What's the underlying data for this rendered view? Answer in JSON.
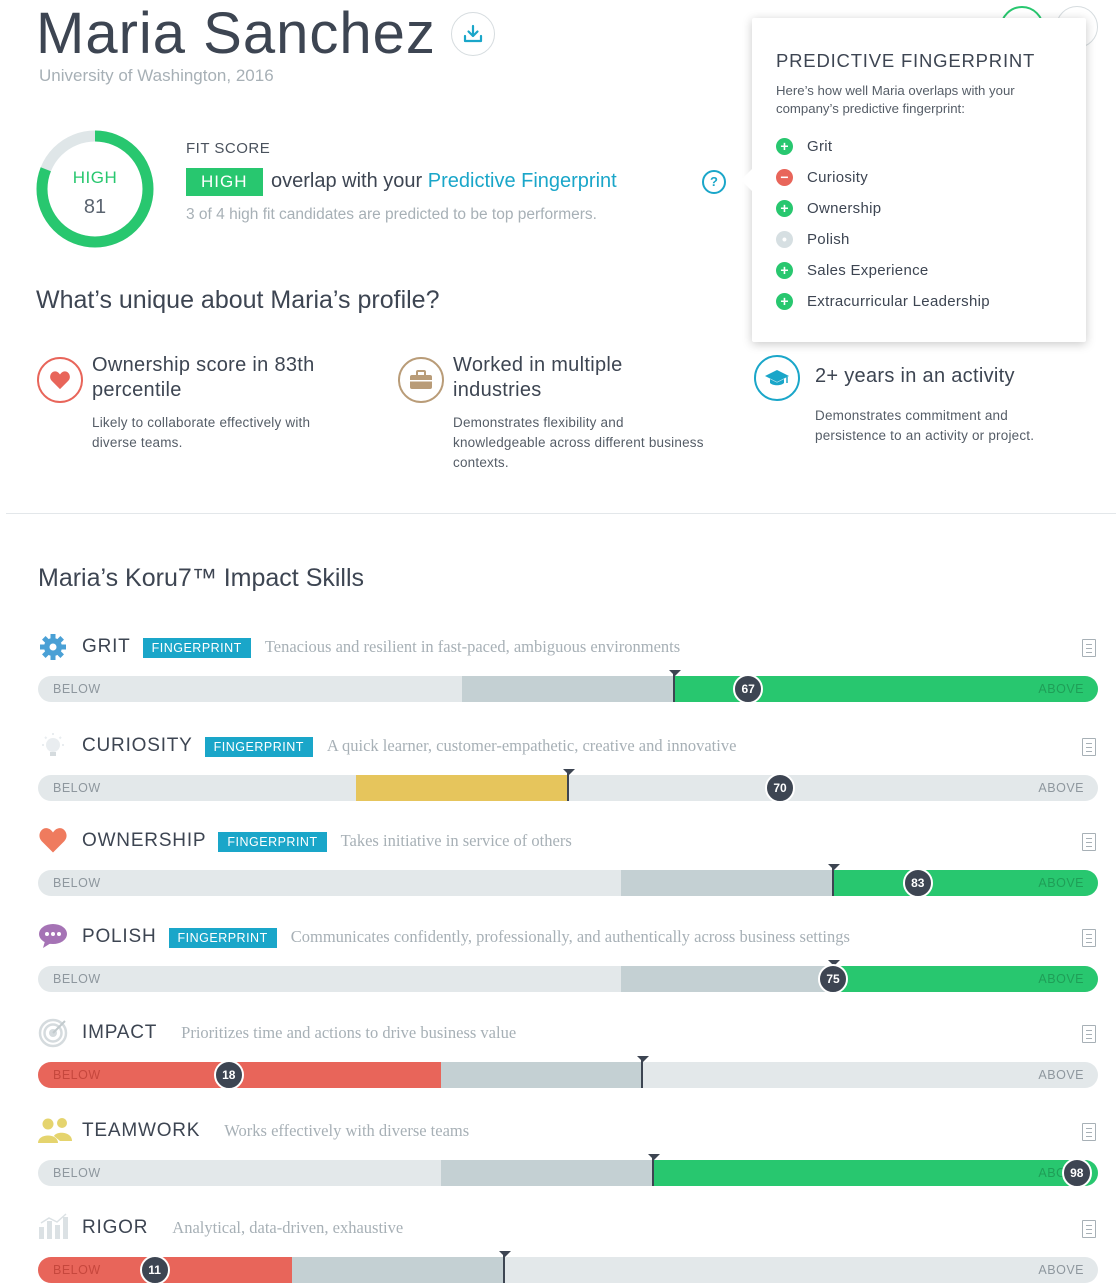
{
  "profile": {
    "name": "Maria Sanchez",
    "education": "University of Washington, 2016"
  },
  "fit": {
    "level": "HIGH",
    "score": "81",
    "score_fraction": 0.81,
    "label": "FIT SCORE",
    "badge": "HIGH",
    "text_before": "overlap with your",
    "link_text": "Predictive Fingerprint",
    "help": "?",
    "note": "3 of 4 high fit candidates are predicted to be top performers."
  },
  "unique": {
    "title": "What’s unique about Maria’s profile?",
    "items": [
      {
        "icon": "heart-icon",
        "title_line1": "Ownership score in 83th",
        "title_line2": "percentile",
        "desc_line1": "Likely to collaborate effectively with",
        "desc_line2": "diverse teams.",
        "desc_line3": ""
      },
      {
        "icon": "briefcase-icon",
        "title_line1": "Worked in multiple",
        "title_line2": "industries",
        "desc_line1": "Demonstrates flexibility and",
        "desc_line2": "knowledgeable across different business",
        "desc_line3": "contexts."
      },
      {
        "icon": "graduation-cap-icon",
        "title_line1": "2+ years in an activity",
        "title_line2": "",
        "desc_line1": "Demonstrates commitment and",
        "desc_line2": "persistence to an activity or project.",
        "desc_line3": ""
      }
    ]
  },
  "popover": {
    "title": "PREDICTIVE FINGERPRINT",
    "desc": "Here’s how well Maria overlaps with your company’s predictive fingerprint:",
    "items": [
      {
        "label": "Grit",
        "status": "plus",
        "symbol": "+"
      },
      {
        "label": "Curiosity",
        "status": "minus",
        "symbol": "−"
      },
      {
        "label": "Ownership",
        "status": "plus",
        "symbol": "+"
      },
      {
        "label": "Polish",
        "status": "neutral",
        "symbol": "•"
      },
      {
        "label": "Sales Experience",
        "status": "plus",
        "symbol": "+"
      },
      {
        "label": "Extracurricular Leadership",
        "status": "plus",
        "symbol": "+"
      }
    ]
  },
  "skills_section": {
    "title": "Maria’s Koru7™ Impact Skills",
    "below_label": "BELOW",
    "above_label": "ABOVE",
    "fingerprint_label": "FINGERPRINT"
  },
  "skills": [
    {
      "name": "GRIT",
      "icon": "gear-icon",
      "fingerprint": true,
      "desc": "Tenacious and resilient in fast-paced, ambiguous environments",
      "score": "67",
      "score_value": 67,
      "marker": 60,
      "range_low": 40,
      "range_high": 60,
      "color": "green"
    },
    {
      "name": "CURIOSITY",
      "icon": "lightbulb-icon",
      "fingerprint": true,
      "desc": "A quick learner, customer-empathetic, creative and innovative",
      "score": "70",
      "score_value": 70,
      "marker": 50,
      "range_low": 30,
      "range_high": 50,
      "color": "yellow"
    },
    {
      "name": "OWNERSHIP",
      "icon": "heart-icon",
      "fingerprint": true,
      "desc": "Takes initiative in service of others",
      "score": "83",
      "score_value": 83,
      "marker": 75,
      "range_low": 55,
      "range_high": 75,
      "color": "green"
    },
    {
      "name": "POLISH",
      "icon": "speech-bubble-icon",
      "fingerprint": true,
      "desc": "Communicates confidently, professionally, and authentically across business settings",
      "score": "75",
      "score_value": 75,
      "marker": 75,
      "range_low": 55,
      "range_high": 75,
      "color": "green"
    },
    {
      "name": "IMPACT",
      "icon": "target-icon",
      "fingerprint": false,
      "desc": "Prioritizes time and actions to drive business value",
      "score": "18",
      "score_value": 18,
      "marker": 57,
      "range_low": 38,
      "range_high": 57,
      "color": "red"
    },
    {
      "name": "TEAMWORK",
      "icon": "people-icon",
      "fingerprint": false,
      "desc": "Works effectively with diverse teams",
      "score": "98",
      "score_value": 98,
      "marker": 58,
      "range_low": 38,
      "range_high": 58,
      "color": "green"
    },
    {
      "name": "RIGOR",
      "icon": "bar-chart-icon",
      "fingerprint": false,
      "desc": "Analytical, data-driven, exhaustive",
      "score": "11",
      "score_value": 11,
      "marker": 44,
      "range_low": 24,
      "range_high": 44,
      "color": "red"
    }
  ],
  "colors": {
    "green": "#28c76f",
    "yellow": "#e6c55c",
    "red": "#e8655a",
    "teal": "#1aa6c9",
    "range": "#c4d0d3",
    "track": "#e3e8ea"
  }
}
